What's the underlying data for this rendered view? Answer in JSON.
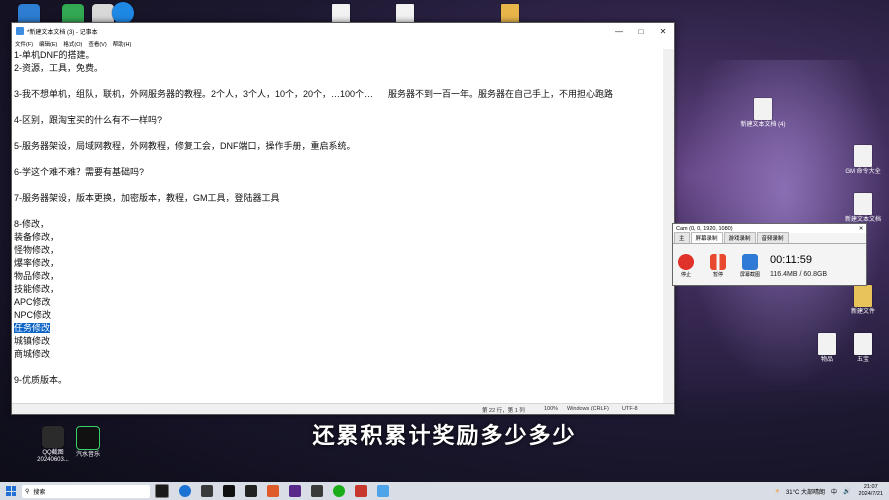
{
  "notepad": {
    "title": "*新建文本文档 (3) - 记事本",
    "menu": [
      "文件(F)",
      "编辑(E)",
      "格式(O)",
      "查看(V)",
      "帮助(H)"
    ],
    "lines": [
      "1-单机DNF的搭建。",
      "2-资源，工具，免费。",
      "",
      "3-我不想单机，组队，联机，外网服务器的教程。2个人，3个人，10个，20个，…100个…      服务器不到一百一年。服务器在自己手上，不用担心跑路",
      "",
      "4-区别，跟淘宝买的什么有不一样吗?",
      "",
      "5-服务器架设，局域网教程，外网教程，修复工会，DNF端口，操作手册，重启系统。",
      "",
      "6-学这个难不难？需要有基础吗?",
      "",
      "7-服务器架设，版本更换，加密版本，教程，GM工具，登陆器工具",
      "",
      "8-修改，",
      "装备修改，",
      "怪物修改，",
      "爆率修改，",
      "物品修改，",
      "技能修改，",
      "APC修改",
      "NPC修改",
      "任务修改",
      "城镇修改",
      "商城修改",
      "",
      "9-优质版本。"
    ],
    "selected_line": "任务修改",
    "status": {
      "position": "第 22 行，第 1 列",
      "zoom": "100%",
      "eol": "Windows (CRLF)",
      "encoding": "UTF-8"
    }
  },
  "recorder": {
    "title": "Cam (0, 0, 1920, 1080)",
    "tabs": [
      "主",
      "屏幕录制",
      "游戏录制",
      "音频录制"
    ],
    "buttons": [
      "停止",
      "暂停",
      "屏幕截图"
    ],
    "elapsed": "00:11:59",
    "file_size": "116.4MB / 60.8GB"
  },
  "desktop": {
    "icons_right": [
      {
        "label": "新建文本文档 (4)"
      },
      {
        "label": "GM 命令大全"
      },
      {
        "label": "新建文本文档"
      },
      {
        "label": "物品"
      },
      {
        "label": "五宝"
      },
      {
        "label": "新建文件"
      }
    ],
    "icons_left": [
      {
        "label": "QQ截图 20240603..."
      },
      {
        "label": "汽水音乐"
      }
    ]
  },
  "subtitle": "还累积累计奖励多少多少",
  "taskbar": {
    "search_placeholder": "搜索",
    "weather": "31°C 大部晴朗",
    "ime": "中",
    "time": "21:07",
    "date": "2024/7/21"
  },
  "colors": {
    "selection": "#0a64c8",
    "stop_red": "#e0322b",
    "pause_red": "#e8492e"
  }
}
